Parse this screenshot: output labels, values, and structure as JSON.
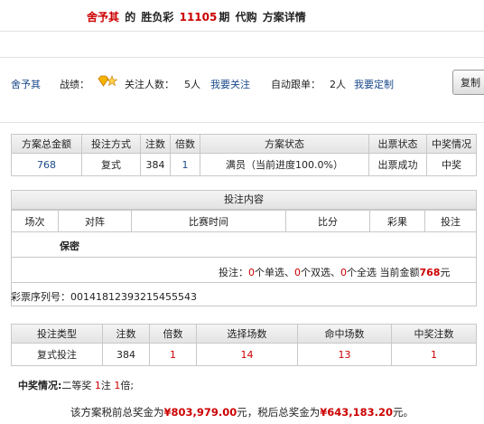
{
  "header": {
    "user": "舍予其",
    "de": "的",
    "game": "胜负彩",
    "period": "11105",
    "qi": "期",
    "daigou": "代购",
    "detail": "方案详情"
  },
  "info": {
    "user": "舍予其",
    "record_label": "战绩：",
    "follow_label": "关注人数：",
    "follow_count": "5人",
    "follow_link": "我要关注",
    "auto_label": "自动跟单：",
    "auto_count": "2人",
    "auto_link": "我要定制",
    "copy_button": "复制"
  },
  "scheme": {
    "headers": [
      "方案总金额",
      "投注方式",
      "注数",
      "倍数",
      "方案状态",
      "出票状态",
      "中奖情况"
    ],
    "row": [
      "768",
      "复式",
      "384",
      "1",
      "满员（当前进度100.0%）",
      "出票成功",
      "中奖"
    ]
  },
  "bet": {
    "title": "投注内容",
    "headers": [
      "场次",
      "对阵",
      "比赛时间",
      "比分",
      "彩果",
      "投注"
    ],
    "secret": "保密",
    "summary_prefix": "投注：",
    "single_n": "0",
    "single_label": "个单选、",
    "double_n": "0",
    "double_label": "个双选、",
    "full_n": "0",
    "full_label": "个全选 当前金额",
    "amount": "768",
    "yuan": "元",
    "serial_label": "彩票序列号：",
    "serial": "00141812393215455543"
  },
  "result": {
    "headers": [
      "投注类型",
      "注数",
      "倍数",
      "选择场数",
      "命中场数",
      "中奖注数"
    ],
    "row": [
      "复式投注",
      "384",
      "1",
      "14",
      "13",
      "1"
    ]
  },
  "prize": {
    "label": "中奖情况:",
    "text1": "二等奖",
    "count": "1",
    "text2": "注",
    "times": "1",
    "text3": "倍;"
  },
  "footer": {
    "prefix": "该方案税前总奖金为",
    "pre_tax": "¥803,979.00",
    "mid": "元，税后总奖金为",
    "after_tax": "¥643,183.20",
    "suffix": "元。"
  }
}
